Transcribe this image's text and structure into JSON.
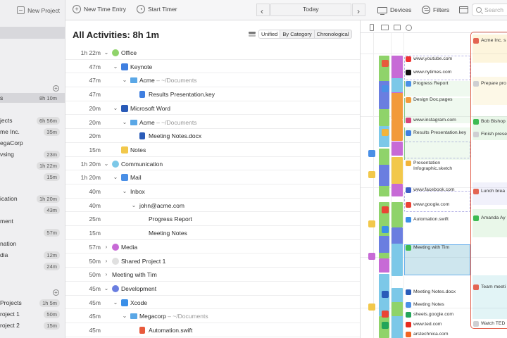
{
  "sidebar": {
    "new_project_label": "New Project",
    "rows": [
      {
        "label": "s",
        "badge": "8h 10m",
        "selected": true
      },
      {
        "label": "",
        "badge": ""
      },
      {
        "label": "jects",
        "badge": "6h 56m"
      },
      {
        "label": "me Inc.",
        "badge": "35m"
      },
      {
        "label": "egaCorp",
        "badge": ""
      },
      {
        "label": "vsing",
        "badge": "23m"
      },
      {
        "label": "",
        "badge": "1h 22m"
      },
      {
        "label": "",
        "badge": "15m"
      },
      {
        "label": "ication",
        "badge": "1h 20m"
      },
      {
        "label": "",
        "badge": "43m"
      },
      {
        "label": "ment",
        "badge": "57m"
      },
      {
        "label": "nation",
        "badge": ""
      },
      {
        "label": "dia",
        "badge": "12m"
      },
      {
        "label": "",
        "badge": "24m"
      },
      {
        "label": "Projects",
        "badge": "1h 5m"
      },
      {
        "label": "roject 1",
        "badge": "50m"
      },
      {
        "label": "roject 2",
        "badge": "15m"
      }
    ]
  },
  "toolbar": {
    "new_time_entry": "New Time Entry",
    "start_timer": "Start Timer",
    "today": "Today",
    "devices": "Devices",
    "filters": "Filters",
    "search_placeholder": "Search"
  },
  "activities": {
    "title": "All Activities: 8h 1m",
    "view_modes": [
      "Unified",
      "By Category",
      "Chronological"
    ],
    "active_mode": "Unified",
    "rows": [
      {
        "dur": "1h 22m",
        "chev": "v",
        "indent": 0,
        "icon": "dot",
        "color": "#8fd36a",
        "name": "Office",
        "sub": ""
      },
      {
        "dur": "47m",
        "chev": "v",
        "indent": 1,
        "icon": "app",
        "color": "#3f7fe0",
        "name": "Keynote",
        "sub": ""
      },
      {
        "dur": "47m",
        "chev": "v",
        "indent": 2,
        "icon": "folder",
        "color": "#5aa7e6",
        "name": "Acme",
        "sub": " – ~/Documents"
      },
      {
        "dur": "47m",
        "chev": "",
        "indent": 3,
        "icon": "file",
        "color": "#3f7fe0",
        "name": "Results Presentation.key",
        "sub": ""
      },
      {
        "dur": "20m",
        "chev": "v",
        "indent": 1,
        "icon": "app",
        "color": "#2a5bb8",
        "name": "Microsoft Word",
        "sub": ""
      },
      {
        "dur": "20m",
        "chev": "v",
        "indent": 2,
        "icon": "folder",
        "color": "#5aa7e6",
        "name": "Acme",
        "sub": " – ~/Documents"
      },
      {
        "dur": "20m",
        "chev": "",
        "indent": 3,
        "icon": "file",
        "color": "#2a5bb8",
        "name": "Meeting Notes.docx",
        "sub": ""
      },
      {
        "dur": "15m",
        "chev": "",
        "indent": 1,
        "icon": "app",
        "color": "#f2c84b",
        "name": "Notes",
        "sub": ""
      },
      {
        "dur": "1h 20m",
        "chev": "v",
        "indent": 0,
        "icon": "dot",
        "color": "#7cc8e8",
        "name": "Communication",
        "sub": ""
      },
      {
        "dur": "1h 20m",
        "chev": "v",
        "indent": 1,
        "icon": "app",
        "color": "#4a8fe6",
        "name": "Mail",
        "sub": ""
      },
      {
        "dur": "40m",
        "chev": "v",
        "indent": 2,
        "icon": "",
        "color": "",
        "name": "Inbox",
        "sub": ""
      },
      {
        "dur": "40m",
        "chev": "v",
        "indent": 3,
        "icon": "",
        "color": "",
        "name": "john@acme.com",
        "sub": ""
      },
      {
        "dur": "25m",
        "chev": "",
        "indent": 4,
        "icon": "",
        "color": "",
        "name": "Progress Report",
        "sub": ""
      },
      {
        "dur": "15m",
        "chev": "",
        "indent": 4,
        "icon": "",
        "color": "",
        "name": "Meeting Notes",
        "sub": ""
      },
      {
        "dur": "57m",
        "chev": ">",
        "indent": 0,
        "icon": "dot",
        "color": "#c76ad6",
        "name": "Media",
        "sub": ""
      },
      {
        "dur": "50m",
        "chev": ">",
        "indent": 0,
        "icon": "dot",
        "color": "#e0e0e0",
        "name": "Shared Project 1",
        "sub": ""
      },
      {
        "dur": "50m",
        "chev": ">",
        "indent": 0,
        "icon": "",
        "color": "",
        "name": "Meeting with Tim",
        "sub": ""
      },
      {
        "dur": "45m",
        "chev": "v",
        "indent": 0,
        "icon": "dot",
        "color": "#6a7ee0",
        "name": "Development",
        "sub": ""
      },
      {
        "dur": "45m",
        "chev": "v",
        "indent": 1,
        "icon": "app",
        "color": "#3a8fe8",
        "name": "Xcode",
        "sub": ""
      },
      {
        "dur": "45m",
        "chev": "v",
        "indent": 2,
        "icon": "folder",
        "color": "#5aa7e6",
        "name": "Megacorp",
        "sub": " – ~/Documents"
      },
      {
        "dur": "45m",
        "chev": "",
        "indent": 3,
        "icon": "file",
        "color": "#e85a3c",
        "name": "Automation.swift",
        "sub": ""
      }
    ]
  },
  "timeline": {
    "cards": [
      {
        "label": "www.youtube.com",
        "icon": "youtube-icon",
        "color": "#e33"
      },
      {
        "label": "www.nytimes.com",
        "icon": "nytimes-icon",
        "color": "#111"
      },
      {
        "label": "Progress Report",
        "icon": "mail-icon",
        "color": "#4a8fe6"
      },
      {
        "label": "Design Doc.pages",
        "icon": "pages-icon",
        "color": "#f29a3a"
      },
      {
        "label": "www.instagram.com",
        "icon": "instagram-icon",
        "color": "#d6437a"
      },
      {
        "label": "Results Presentation.key",
        "icon": "keynote-icon",
        "color": "#3f7fe0"
      },
      {
        "label": "Presentation Infographic.sketch",
        "icon": "sketch-icon",
        "color": "#f2b43a"
      },
      {
        "label": "www.facebook.com",
        "icon": "facebook-icon",
        "color": "#3b5fc6"
      },
      {
        "label": "www.google.com",
        "icon": "google-icon",
        "color": "#ea4335"
      },
      {
        "label": "Automation.swift",
        "icon": "xcode-icon",
        "color": "#3a8fe8"
      },
      {
        "label": "Meeting with Tim",
        "icon": "facetime-icon",
        "color": "#3dbb52"
      },
      {
        "label": "Meeting Notes.docx",
        "icon": "word-icon",
        "color": "#2a5bb8"
      },
      {
        "label": "Meeting Notes",
        "icon": "mail-icon",
        "color": "#4a8fe6"
      },
      {
        "label": "sheets.google.com",
        "icon": "sheets-icon",
        "color": "#23a55a"
      },
      {
        "label": "www.ted.com",
        "icon": "ted-icon",
        "color": "#e62b1e"
      },
      {
        "label": "arstechnica.com",
        "icon": "ars-icon",
        "color": "#f26522"
      }
    ],
    "calendar": [
      {
        "label": "Acme Inc. s",
        "icon": "calendar-icon"
      },
      {
        "label": "Prepare pro",
        "icon": "task-icon"
      },
      {
        "label": "Bob Bishop",
        "icon": "whatsapp-icon"
      },
      {
        "label": "Finish prese",
        "icon": "task-icon"
      },
      {
        "label": "Lunch brea",
        "icon": "calendar-icon"
      },
      {
        "label": "Amanda Ay",
        "icon": "whatsapp-icon"
      },
      {
        "label": "Team meeti",
        "icon": "calendar-icon"
      },
      {
        "label": "Watch TED",
        "icon": "task-icon"
      }
    ]
  }
}
